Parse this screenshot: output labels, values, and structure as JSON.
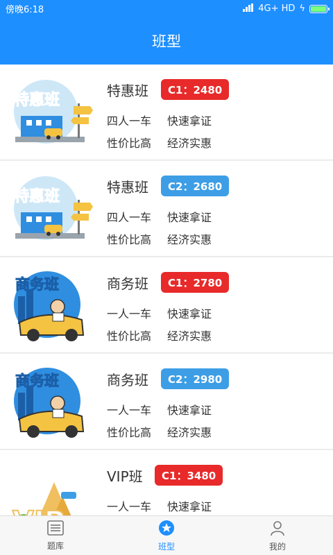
{
  "statusbar": {
    "time": "傍晚6:18",
    "network": "4G+ HD"
  },
  "header": {
    "title": "班型"
  },
  "classes": [
    {
      "name": "特惠班",
      "badge": "C1：2480",
      "badge_color": "#e82a2a",
      "feature1": "四人一车",
      "feature2": "快速拿证",
      "feature3": "性价比高",
      "feature4": "经济实惠",
      "image_icon": "discount-class-illustration"
    },
    {
      "name": "特惠班",
      "badge": "C2：2680",
      "badge_color": "#3d9ee6",
      "feature1": "四人一车",
      "feature2": "快速拿证",
      "feature3": "性价比高",
      "feature4": "经济实惠",
      "image_icon": "discount-class-illustration"
    },
    {
      "name": "商务班",
      "badge": "C1：2780",
      "badge_color": "#e82a2a",
      "feature1": "一人一车",
      "feature2": "快速拿证",
      "feature3": "性价比高",
      "feature4": "经济实惠",
      "image_icon": "business-class-illustration"
    },
    {
      "name": "商务班",
      "badge": "C2：2980",
      "badge_color": "#3d9ee6",
      "feature1": "一人一车",
      "feature2": "快速拿证",
      "feature3": "性价比高",
      "feature4": "经济实惠",
      "image_icon": "business-class-illustration"
    },
    {
      "name": "VIP班",
      "badge": "C1：3480",
      "badge_color": "#e82a2a",
      "feature1": "一人一车",
      "feature2": "快速拿证",
      "image_icon": "vip-class-illustration"
    }
  ],
  "tabs": [
    {
      "label": "题库",
      "icon": "question-bank-icon"
    },
    {
      "label": "班型",
      "icon": "star-icon"
    },
    {
      "label": "我的",
      "icon": "user-icon"
    }
  ],
  "colors": {
    "primary": "#1e8fff",
    "badge_red": "#e82a2a",
    "badge_blue": "#3d9ee6"
  }
}
